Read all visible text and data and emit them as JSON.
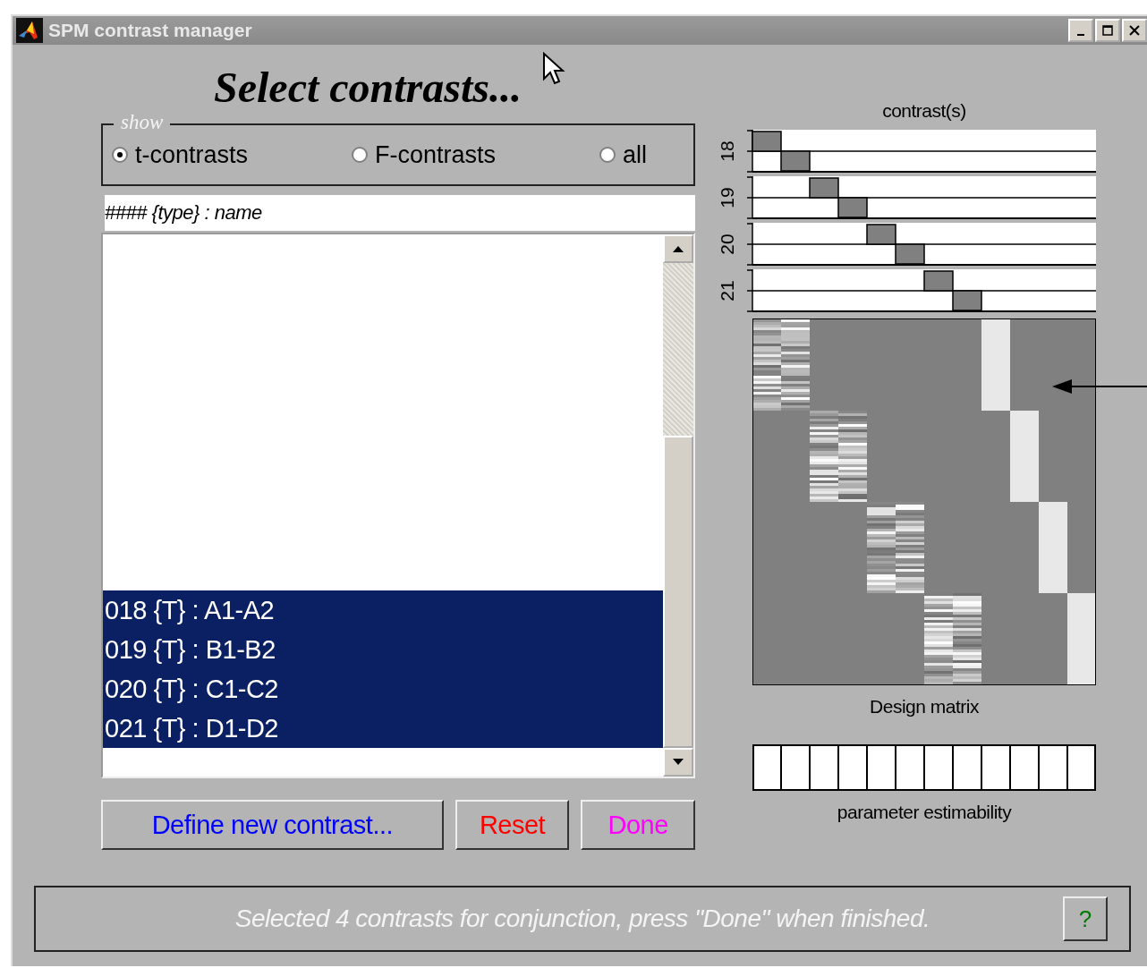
{
  "window": {
    "title": "SPM contrast manager"
  },
  "heading": "Select contrasts...",
  "show": {
    "legend": "show",
    "options": [
      {
        "label": "t-contrasts",
        "selected": true
      },
      {
        "label": "F-contrasts",
        "selected": false
      },
      {
        "label": "all",
        "selected": false
      }
    ]
  },
  "list": {
    "header": "#### {type} : name",
    "items": [
      {
        "label": "018 {T} : A1-A2",
        "selected": true
      },
      {
        "label": "019 {T} : B1-B2",
        "selected": true
      },
      {
        "label": "020 {T} : C1-C2",
        "selected": true
      },
      {
        "label": "021 {T} : D1-D2",
        "selected": true
      }
    ]
  },
  "buttons": [
    {
      "label": "Define new contrast...",
      "color": "#0000ff"
    },
    {
      "label": "Reset",
      "color": "#ff0000"
    },
    {
      "label": "Done",
      "color": "#ff00ff"
    }
  ],
  "contrast_panel": {
    "title": "contrast(s)",
    "contrasts": [
      {
        "label": "18"
      },
      {
        "label": "19"
      },
      {
        "label": "20"
      },
      {
        "label": "21"
      }
    ]
  },
  "design_matrix": {
    "caption": "Design matrix"
  },
  "estimability": {
    "caption": "parameter estimability"
  },
  "status": {
    "message": "Selected 4 contrasts for conjunction, press \"Done\" when finished.",
    "help": "?"
  }
}
